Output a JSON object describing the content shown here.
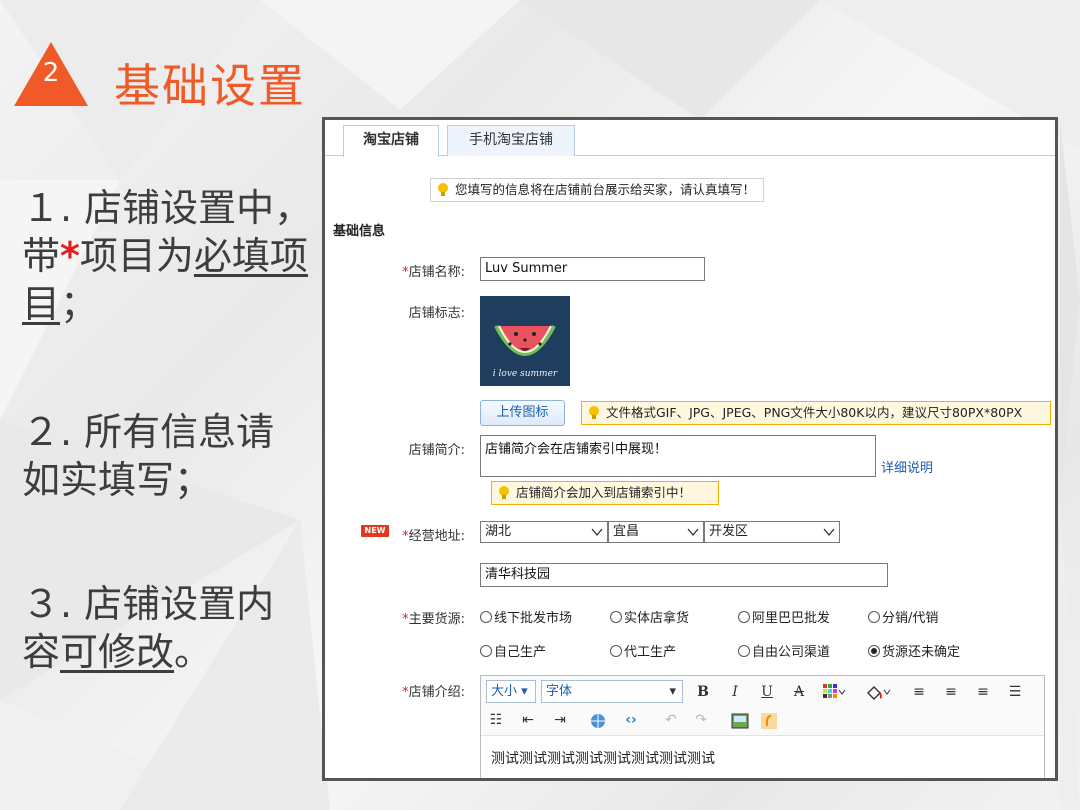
{
  "heading": {
    "number": "2",
    "title": "基础设置",
    "accent_color": "#f05a28"
  },
  "notes": {
    "n1": {
      "prefix": "１. 店铺设置中，带",
      "star": "*",
      "mid": "项目为",
      "underlined": "必填项目",
      "suffix": "；"
    },
    "n2": {
      "text": "２. 所有信息请如实填写；"
    },
    "n3": {
      "prefix": "３. 店铺设置内容",
      "underlined": "可修改",
      "suffix": "。"
    }
  },
  "tabs": [
    {
      "label": "淘宝店铺",
      "active": true
    },
    {
      "label": "手机淘宝店铺",
      "active": false
    }
  ],
  "top_hint": "您填写的信息将在店铺前台展示给买家，请认真填写！",
  "section_title": "基础信息",
  "fields": {
    "name": {
      "req": "*",
      "label": "店铺名称:",
      "value": "Luv Summer"
    },
    "logo": {
      "label": "店铺标志:",
      "logo_text": "i love summer",
      "upload_label": "上传图标",
      "hint": "文件格式GIF、JPG、JPEG、PNG文件大小80K以内，建议尺寸80PX*80PX"
    },
    "intro": {
      "label": "店铺简介:",
      "value": "店铺简介会在店铺索引中展现！",
      "link": "详细说明",
      "hint": "店铺简介会加入到店铺索引中！"
    },
    "address": {
      "new_badge": "NEW",
      "req": "*",
      "label": "经营地址:",
      "province": "湖北",
      "city": "宜昌",
      "district": "开发区",
      "street": "清华科技园"
    },
    "source": {
      "req": "*",
      "label": "主要货源:",
      "options": [
        "线下批发市场",
        "实体店拿货",
        "阿里巴巴批发",
        "分销/代销",
        "自己生产",
        "代工生产",
        "自由公司渠道",
        "货源还未确定"
      ],
      "selected_index": 7
    },
    "description": {
      "req": "*",
      "label": "店铺介绍:",
      "size_select": "大小",
      "font_select": "字体",
      "content": "测试测试测试测试测试测试测试测试"
    }
  }
}
